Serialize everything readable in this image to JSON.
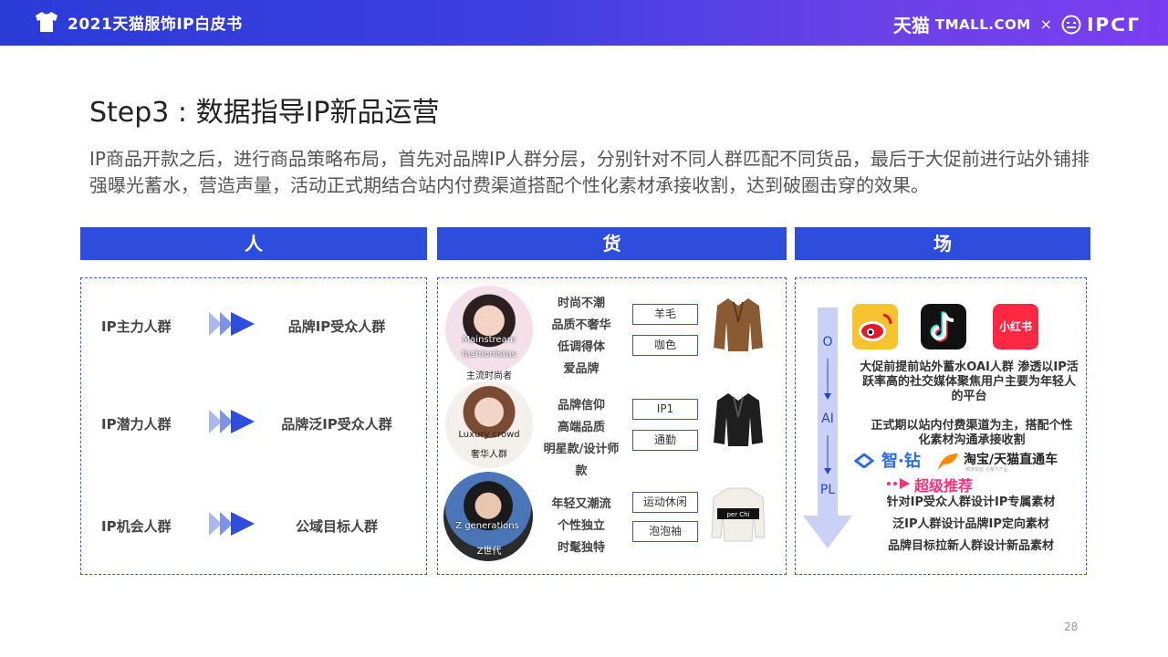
{
  "header": {
    "title": "2021天猫服饰IP白皮书",
    "brand_cn": "天猫",
    "brand_en": "TMALL.COM",
    "times": "×",
    "partner": "IPᑕᒥ"
  },
  "heading": "Step3 : 数据指导IP新品运营",
  "intro": "IP商品开款之后，进行商品策略布局，首先对品牌IP人群分层，分别针对不同人群匹配不同货品，最后于大促前进行站外铺排强曝光蓄水，营造声量，活动正式期结合站内付费渠道搭配个性化素材承接收割，达到破圈击穿的效果。",
  "columns": {
    "people": "人",
    "goods": "货",
    "scene": "场"
  },
  "people": [
    {
      "source": "IP主力人群",
      "target": "品牌IP受众人群"
    },
    {
      "source": "IP潜力人群",
      "target": "品牌泛IP受众人群"
    },
    {
      "source": "IP机会人群",
      "target": "公域目标人群"
    }
  ],
  "goods": [
    {
      "caption_en": "Mainstream fashionistas",
      "caption_cn": "主流时尚者",
      "traits": [
        "时尚不潮",
        "品质不奢华",
        "低调得体",
        "爱品牌"
      ],
      "tags": [
        "羊毛",
        "咖色"
      ]
    },
    {
      "caption_en": "Luxury crowd",
      "caption_cn": "奢华人群",
      "traits": [
        "品牌信仰",
        "高端品质",
        "明星款/设计师款"
      ],
      "tags": [
        "IP1",
        "通勤"
      ]
    },
    {
      "caption_en": "Z generations",
      "caption_cn": "Z世代",
      "traits": [
        "年轻又潮流",
        "个性独立",
        "时髦独特"
      ],
      "tags": [
        "运动休闲",
        "泡泡袖"
      ]
    }
  ],
  "scene": {
    "arrow_labels": [
      "O",
      "AI",
      "PL"
    ],
    "xhs_label": "小红书",
    "pre_promo": "大促前提前站外蓄水OAI人群 渗透以IP活跃率高的社交媒体聚焦用户主要为年轻人的平台",
    "formal": "正式期以站内付费渠道为主，搭配个性化素材沟通承接收割",
    "zhizuan": "智·钻",
    "ztc": "淘宝/天猫直通车",
    "ztc_sub": "精准投放 引爆下产品",
    "chaoji": "超级推荐",
    "lines": [
      "针对IP受众人群设计IP专属素材",
      "泛IP人群设计品牌IP定向素材",
      "品牌目标拉新人群设计新品素材"
    ]
  },
  "page_number": "28",
  "colors": {
    "accent": "#2e4ddd",
    "dash": "#3f59d6",
    "arrow": "#c9d2f6"
  }
}
